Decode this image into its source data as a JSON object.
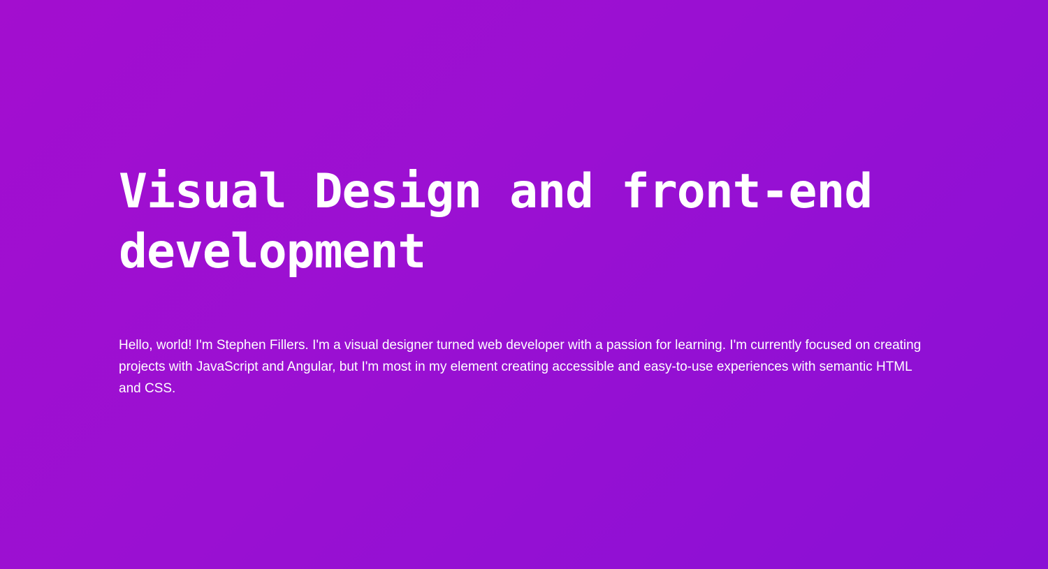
{
  "hero": {
    "title": "Visual Design and front-end development",
    "intro": "Hello, world! I'm Stephen Fillers. I'm a visual designer turned web developer with a passion for learning. I'm currently focused on creating projects with JavaScript and Angular, but I'm most in my element creating accessible and easy-to-use experiences with semantic HTML and CSS."
  },
  "colors": {
    "background_start": "#a30ecf",
    "background_end": "#8a10d5",
    "text": "#ffffff"
  }
}
